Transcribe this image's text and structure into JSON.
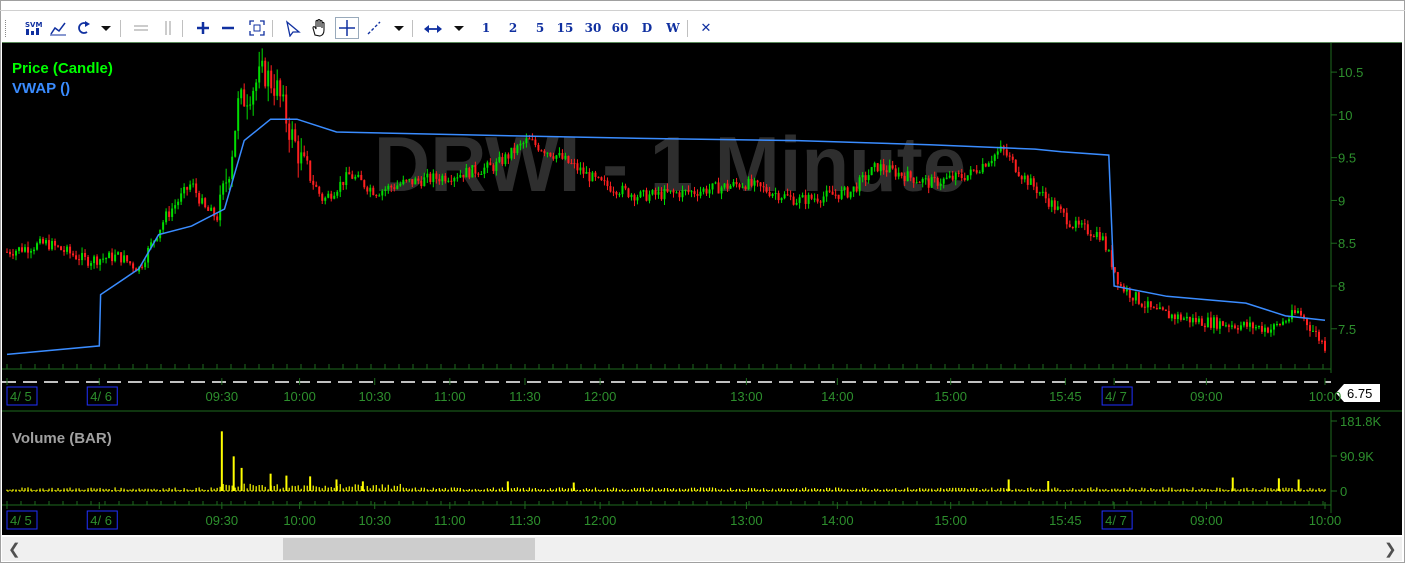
{
  "toolbar": {
    "buttons": [
      {
        "name": "svm-icon",
        "x": 20
      },
      {
        "name": "line-chart-icon",
        "x": 45
      },
      {
        "name": "undo-icon",
        "x": 70
      },
      {
        "name": "dropdown-arrow-icon",
        "x": 93
      },
      {
        "name": "hline-icon",
        "x": 128
      },
      {
        "name": "vline-icon",
        "x": 155
      },
      {
        "name": "zoom-in-icon",
        "x": 190
      },
      {
        "name": "zoom-out-icon",
        "x": 215
      },
      {
        "name": "fit-icon",
        "x": 244
      },
      {
        "name": "pointer-icon",
        "x": 280
      },
      {
        "name": "hand-icon",
        "x": 306
      },
      {
        "name": "crosshair-icon",
        "x": 334
      },
      {
        "name": "trendline-icon",
        "x": 361
      },
      {
        "name": "dropdown-arrow-icon-2",
        "x": 386
      },
      {
        "name": "pan-horizontal-icon",
        "x": 420
      },
      {
        "name": "dropdown-arrow-icon-3",
        "x": 446
      }
    ],
    "periods": [
      "1",
      "2",
      "5",
      "15",
      "30",
      "60",
      "D",
      "W"
    ],
    "close_label": "✕"
  },
  "chart_data": {
    "type": "candlestick",
    "title": "DRWI - 1 Minute",
    "price_legend": "Price (Candle)",
    "vwap_legend": "VWAP ()",
    "volume_legend": "Volume (BAR)",
    "price_axis": {
      "ticks": [
        "10.5",
        "10",
        "9.5",
        "9",
        "8.5",
        "8",
        "7.5"
      ],
      "values": [
        10.5,
        10,
        9.5,
        9,
        8.5,
        8,
        7.5
      ],
      "ylim": [
        7.1,
        10.7
      ]
    },
    "volume_axis": {
      "ticks": [
        "181.8K",
        "90.9K",
        "0"
      ],
      "values": [
        181800,
        90900,
        0
      ]
    },
    "time_labels": [
      "4/ 5",
      "4/ 6",
      "09:30",
      "10:00",
      "10:30",
      "11:00",
      "11:30",
      "12:00",
      "13:00",
      "14:00",
      "15:00",
      "15:45",
      "4/ 7",
      "09:00",
      "10:00"
    ],
    "time_label_fracs": [
      0.0,
      0.07,
      0.163,
      0.222,
      0.279,
      0.336,
      0.393,
      0.45,
      0.561,
      0.63,
      0.716,
      0.803,
      0.84,
      0.91,
      1.0
    ],
    "date_boxes": [
      "4/ 5",
      "4/ 6",
      "4/ 7"
    ],
    "last_price": "6.75",
    "price_series": [
      {
        "t": 0.0,
        "p": 8.4
      },
      {
        "t": 0.03,
        "p": 8.5
      },
      {
        "t": 0.06,
        "p": 8.3
      },
      {
        "t": 0.085,
        "p": 8.35
      },
      {
        "t": 0.1,
        "p": 8.2
      },
      {
        "t": 0.12,
        "p": 8.8
      },
      {
        "t": 0.14,
        "p": 9.2
      },
      {
        "t": 0.15,
        "p": 8.9
      },
      {
        "t": 0.16,
        "p": 8.8
      },
      {
        "t": 0.17,
        "p": 9.5
      },
      {
        "t": 0.175,
        "p": 10.1
      },
      {
        "t": 0.185,
        "p": 10.3
      },
      {
        "t": 0.195,
        "p": 10.5
      },
      {
        "t": 0.205,
        "p": 10.3
      },
      {
        "t": 0.215,
        "p": 9.8
      },
      {
        "t": 0.225,
        "p": 9.4
      },
      {
        "t": 0.24,
        "p": 9.0
      },
      {
        "t": 0.26,
        "p": 9.3
      },
      {
        "t": 0.28,
        "p": 9.1
      },
      {
        "t": 0.3,
        "p": 9.2
      },
      {
        "t": 0.34,
        "p": 9.3
      },
      {
        "t": 0.37,
        "p": 9.4
      },
      {
        "t": 0.395,
        "p": 9.7
      },
      {
        "t": 0.42,
        "p": 9.5
      },
      {
        "t": 0.45,
        "p": 9.2
      },
      {
        "t": 0.48,
        "p": 9.05
      },
      {
        "t": 0.52,
        "p": 9.1
      },
      {
        "t": 0.56,
        "p": 9.2
      },
      {
        "t": 0.6,
        "p": 9.0
      },
      {
        "t": 0.64,
        "p": 9.1
      },
      {
        "t": 0.66,
        "p": 9.4
      },
      {
        "t": 0.7,
        "p": 9.2
      },
      {
        "t": 0.73,
        "p": 9.3
      },
      {
        "t": 0.755,
        "p": 9.6
      },
      {
        "t": 0.77,
        "p": 9.3
      },
      {
        "t": 0.79,
        "p": 9.0
      },
      {
        "t": 0.81,
        "p": 8.7
      },
      {
        "t": 0.83,
        "p": 8.6
      },
      {
        "t": 0.845,
        "p": 8.0
      },
      {
        "t": 0.87,
        "p": 7.7
      },
      {
        "t": 0.9,
        "p": 7.6
      },
      {
        "t": 0.93,
        "p": 7.55
      },
      {
        "t": 0.96,
        "p": 7.5
      },
      {
        "t": 0.98,
        "p": 7.7
      },
      {
        "t": 1.0,
        "p": 7.3
      }
    ],
    "vwap_series": [
      {
        "t": 0.0,
        "p": 7.2
      },
      {
        "t": 0.07,
        "p": 7.3
      },
      {
        "t": 0.071,
        "p": 7.9
      },
      {
        "t": 0.1,
        "p": 8.2
      },
      {
        "t": 0.115,
        "p": 8.6
      },
      {
        "t": 0.14,
        "p": 8.7
      },
      {
        "t": 0.165,
        "p": 8.9
      },
      {
        "t": 0.18,
        "p": 9.7
      },
      {
        "t": 0.2,
        "p": 9.95
      },
      {
        "t": 0.22,
        "p": 9.95
      },
      {
        "t": 0.25,
        "p": 9.8
      },
      {
        "t": 0.4,
        "p": 9.75
      },
      {
        "t": 0.5,
        "p": 9.72
      },
      {
        "t": 0.6,
        "p": 9.7
      },
      {
        "t": 0.7,
        "p": 9.65
      },
      {
        "t": 0.78,
        "p": 9.6
      },
      {
        "t": 0.8,
        "p": 9.57
      },
      {
        "t": 0.836,
        "p": 9.53
      },
      {
        "t": 0.84,
        "p": 8.0
      },
      {
        "t": 0.88,
        "p": 7.88
      },
      {
        "t": 0.94,
        "p": 7.8
      },
      {
        "t": 0.97,
        "p": 7.65
      },
      {
        "t": 1.0,
        "p": 7.6
      }
    ],
    "volume_series": [
      {
        "t": 0.163,
        "v": 155000
      },
      {
        "t": 0.172,
        "v": 90000
      },
      {
        "t": 0.178,
        "v": 60000
      },
      {
        "t": 0.2,
        "v": 45000
      },
      {
        "t": 0.212,
        "v": 40000
      },
      {
        "t": 0.23,
        "v": 38000
      },
      {
        "t": 0.25,
        "v": 30000
      },
      {
        "t": 0.27,
        "v": 25000
      },
      {
        "t": 0.38,
        "v": 25000
      },
      {
        "t": 0.43,
        "v": 22000
      },
      {
        "t": 0.76,
        "v": 30000
      },
      {
        "t": 0.79,
        "v": 26000
      },
      {
        "t": 0.93,
        "v": 35000
      },
      {
        "t": 0.965,
        "v": 33000
      },
      {
        "t": 0.98,
        "v": 30000
      }
    ]
  },
  "colors": {
    "up": "#00dd00",
    "down": "#ff2020",
    "vwap": "#3a8cff",
    "volume": "#ffff00",
    "axis_text": "#2d8f2d",
    "grid": "#1e6a1e",
    "watermark": "#2e2e2e",
    "legend_price": "#00ff00",
    "legend_vwap": "#3a8cff",
    "legend_volume": "#a0a0a0",
    "box": "#2030ff"
  }
}
